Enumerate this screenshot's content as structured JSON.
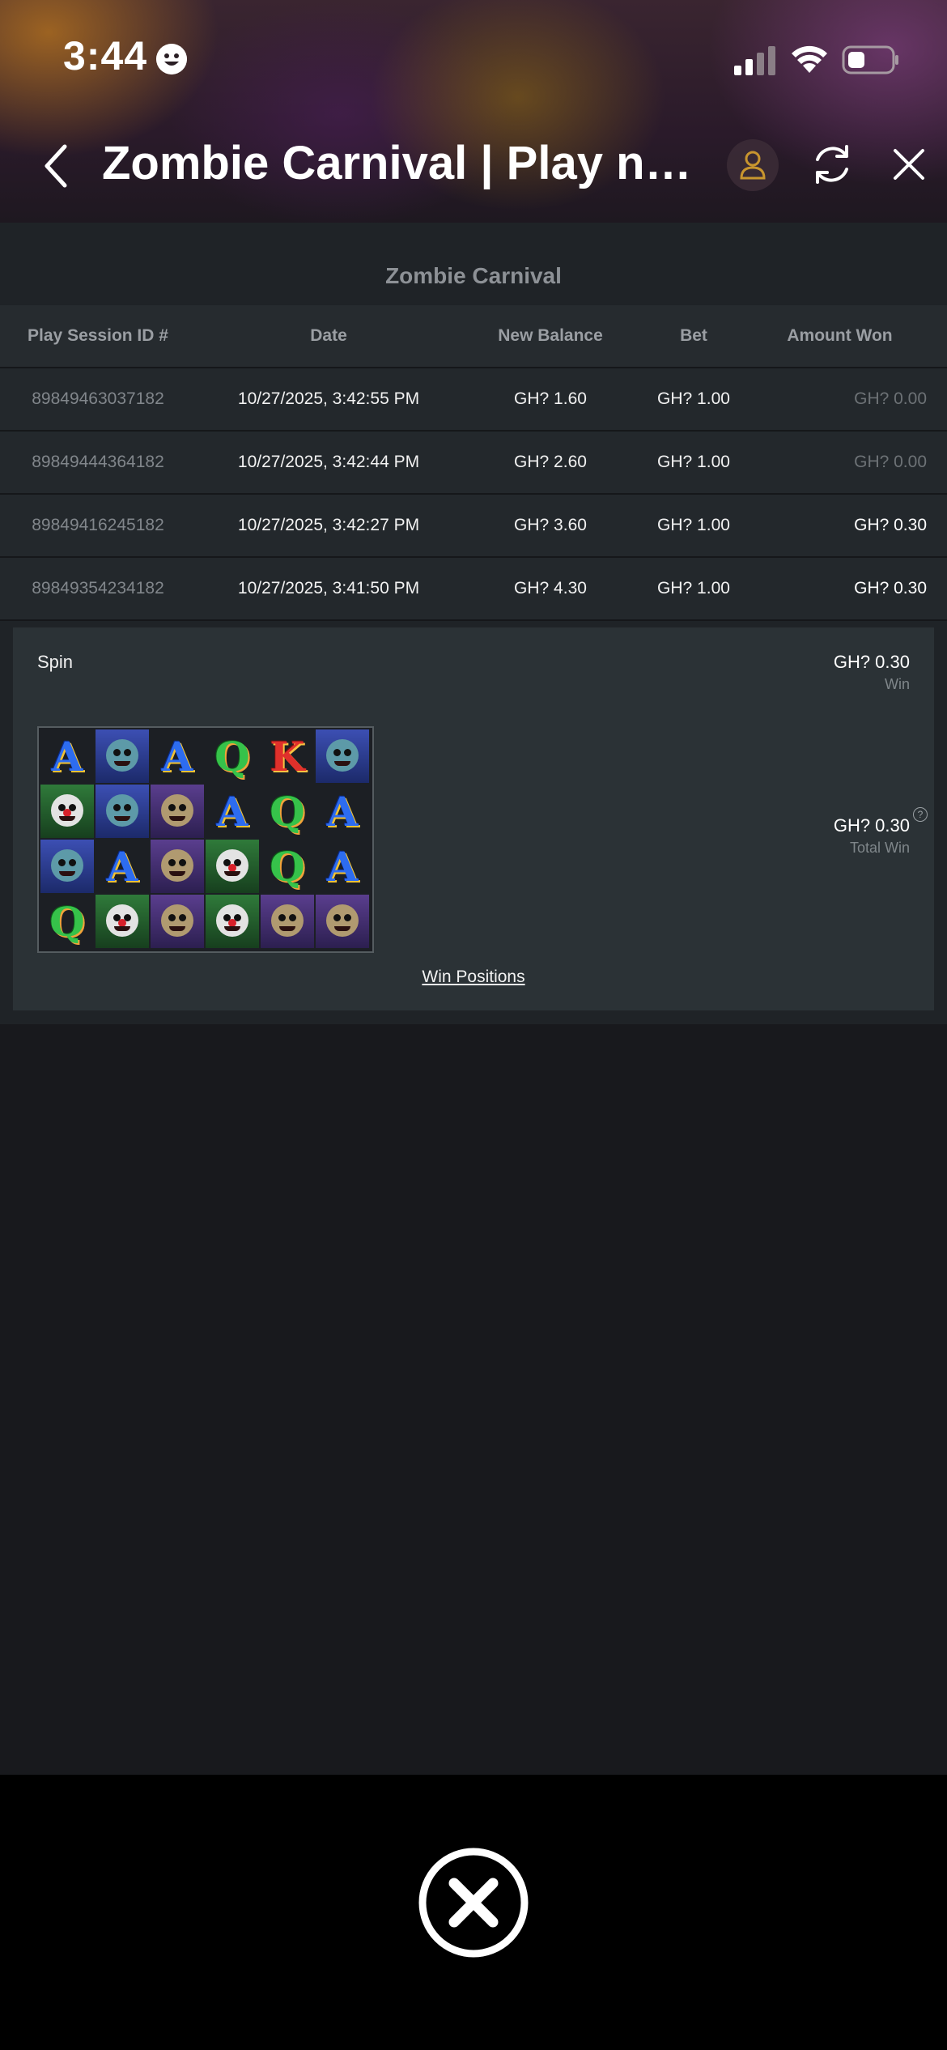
{
  "status_bar": {
    "time": "3:44"
  },
  "nav": {
    "title": "Zombie Carnival | Play now...",
    "back_icon": "chevron-left-icon",
    "profile_icon": "user-icon",
    "refresh_icon": "refresh-icon",
    "close_icon": "close-icon",
    "profile_accent": "#c8952e"
  },
  "history": {
    "game_name": "Zombie Carnival",
    "columns": [
      "Play Session ID #",
      "Date",
      "New Balance",
      "Bet",
      "Amount Won"
    ],
    "rows": [
      {
        "id": "89849463037182",
        "date": "10/27/2025, 3:42:55 PM",
        "balance": "GH? 1.60",
        "bet": "GH? 1.00",
        "won": "GH? 0.00"
      },
      {
        "id": "89849444364182",
        "date": "10/27/2025, 3:42:44 PM",
        "balance": "GH? 2.60",
        "bet": "GH? 1.00",
        "won": "GH? 0.00"
      },
      {
        "id": "89849416245182",
        "date": "10/27/2025, 3:42:27 PM",
        "balance": "GH? 3.60",
        "bet": "GH? 1.00",
        "won": "GH? 0.30"
      },
      {
        "id": "89849354234182",
        "date": "10/27/2025, 3:41:50 PM",
        "balance": "GH? 4.30",
        "bet": "GH? 1.00",
        "won": "GH? 0.30"
      }
    ]
  },
  "detail": {
    "spin_label": "Spin",
    "win_amount": "GH? 0.30",
    "win_caption": "Win",
    "total_amount": "GH? 0.30",
    "total_caption": "Total Win",
    "help_glyph": "?",
    "win_positions_link": "Win Positions",
    "reel_symbols": [
      [
        "A",
        "zombie-blue",
        "A",
        "Q",
        "K",
        "zombie-blue"
      ],
      [
        "zombie-clown",
        "zombie-blue",
        "zombie-purple",
        "A",
        "Q",
        "A"
      ],
      [
        "zombie-blue",
        "A",
        "zombie-purple",
        "zombie-clown",
        "Q",
        "A"
      ],
      [
        "Q",
        "zombie-clown",
        "zombie-purple",
        "zombie-clown",
        "zombie-purple",
        "zombie-purple"
      ]
    ]
  },
  "bottom": {
    "close_icon": "close-circle-icon"
  }
}
